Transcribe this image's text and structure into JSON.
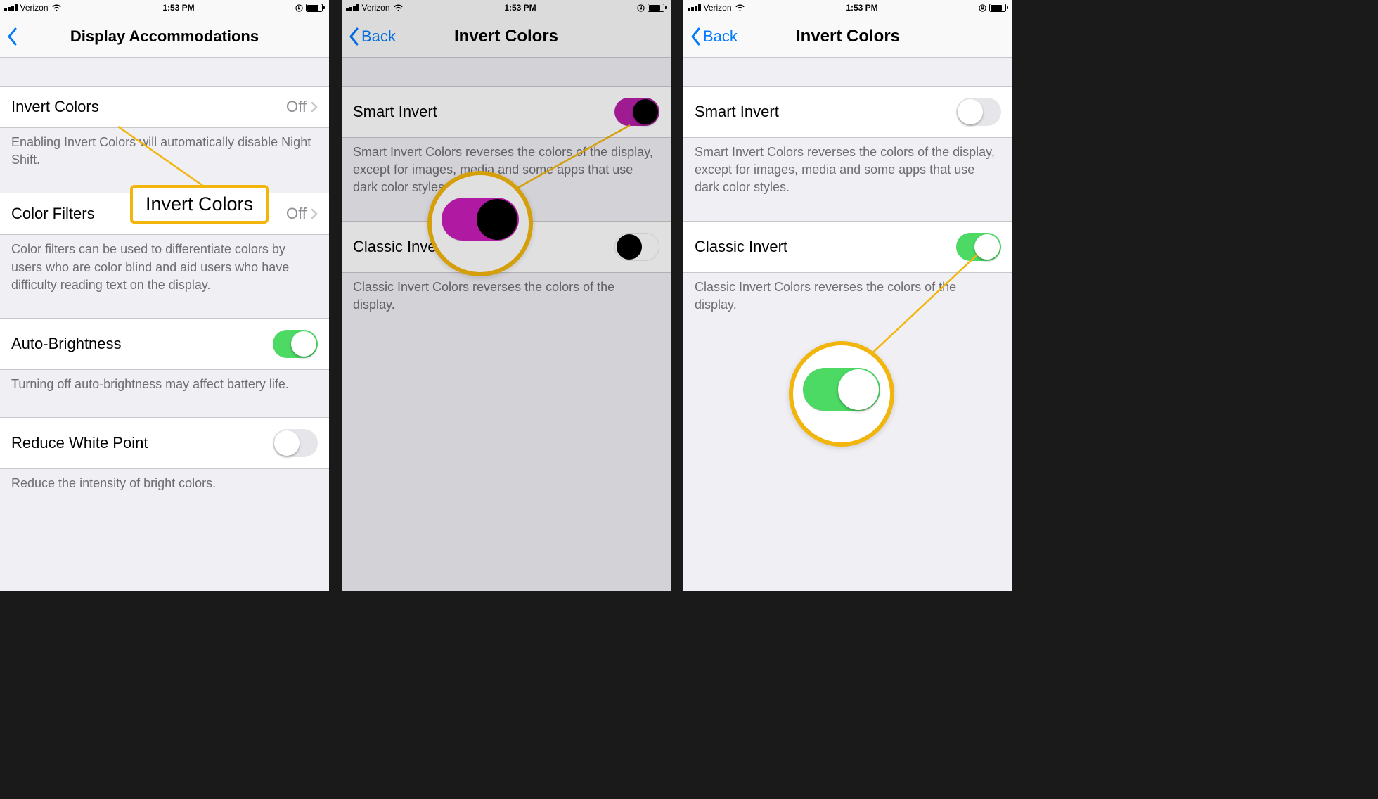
{
  "status": {
    "carrier": "Verizon",
    "time": "1:53 PM"
  },
  "screen1": {
    "title": "Display Accommodations",
    "rows": {
      "invert": {
        "label": "Invert Colors",
        "value": "Off"
      },
      "invertFooter": "Enabling Invert Colors will automatically disable Night Shift.",
      "colorFilters": {
        "label": "Color Filters",
        "value": "Off"
      },
      "colorFiltersFooter": "Color filters can be used to differentiate colors by users who are color blind and aid users who have difficulty reading text on the display.",
      "autoBrightness": {
        "label": "Auto-Brightness"
      },
      "autoBrightnessFooter": "Turning off auto-brightness may affect battery life.",
      "reduceWhite": {
        "label": "Reduce White Point"
      },
      "reduceWhiteFooter": "Reduce the intensity of bright colors."
    },
    "callout": "Invert Colors"
  },
  "screen2": {
    "back": "Back",
    "title": "Invert Colors",
    "rows": {
      "smart": {
        "label": "Smart Invert"
      },
      "smartFooter": "Smart Invert Colors reverses the colors of the display, except for images, media and some apps that use dark color styles.",
      "classic": {
        "label": "Classic Invert"
      },
      "classicFooter": "Classic Invert Colors reverses the colors of the display."
    }
  },
  "screen3": {
    "back": "Back",
    "title": "Invert Colors",
    "rows": {
      "smart": {
        "label": "Smart Invert"
      },
      "smartFooter": "Smart Invert Colors reverses the colors of the display, except for images, media and some apps that use dark color styles.",
      "classic": {
        "label": "Classic Invert"
      },
      "classicFooter": "Classic Invert Colors reverses the colors of the display."
    }
  },
  "colors": {
    "accent_blue": "#007aff",
    "toggle_green": "#4cd964",
    "toggle_magenta": "#b51fa6",
    "callout_yellow": "#f2b50c"
  }
}
